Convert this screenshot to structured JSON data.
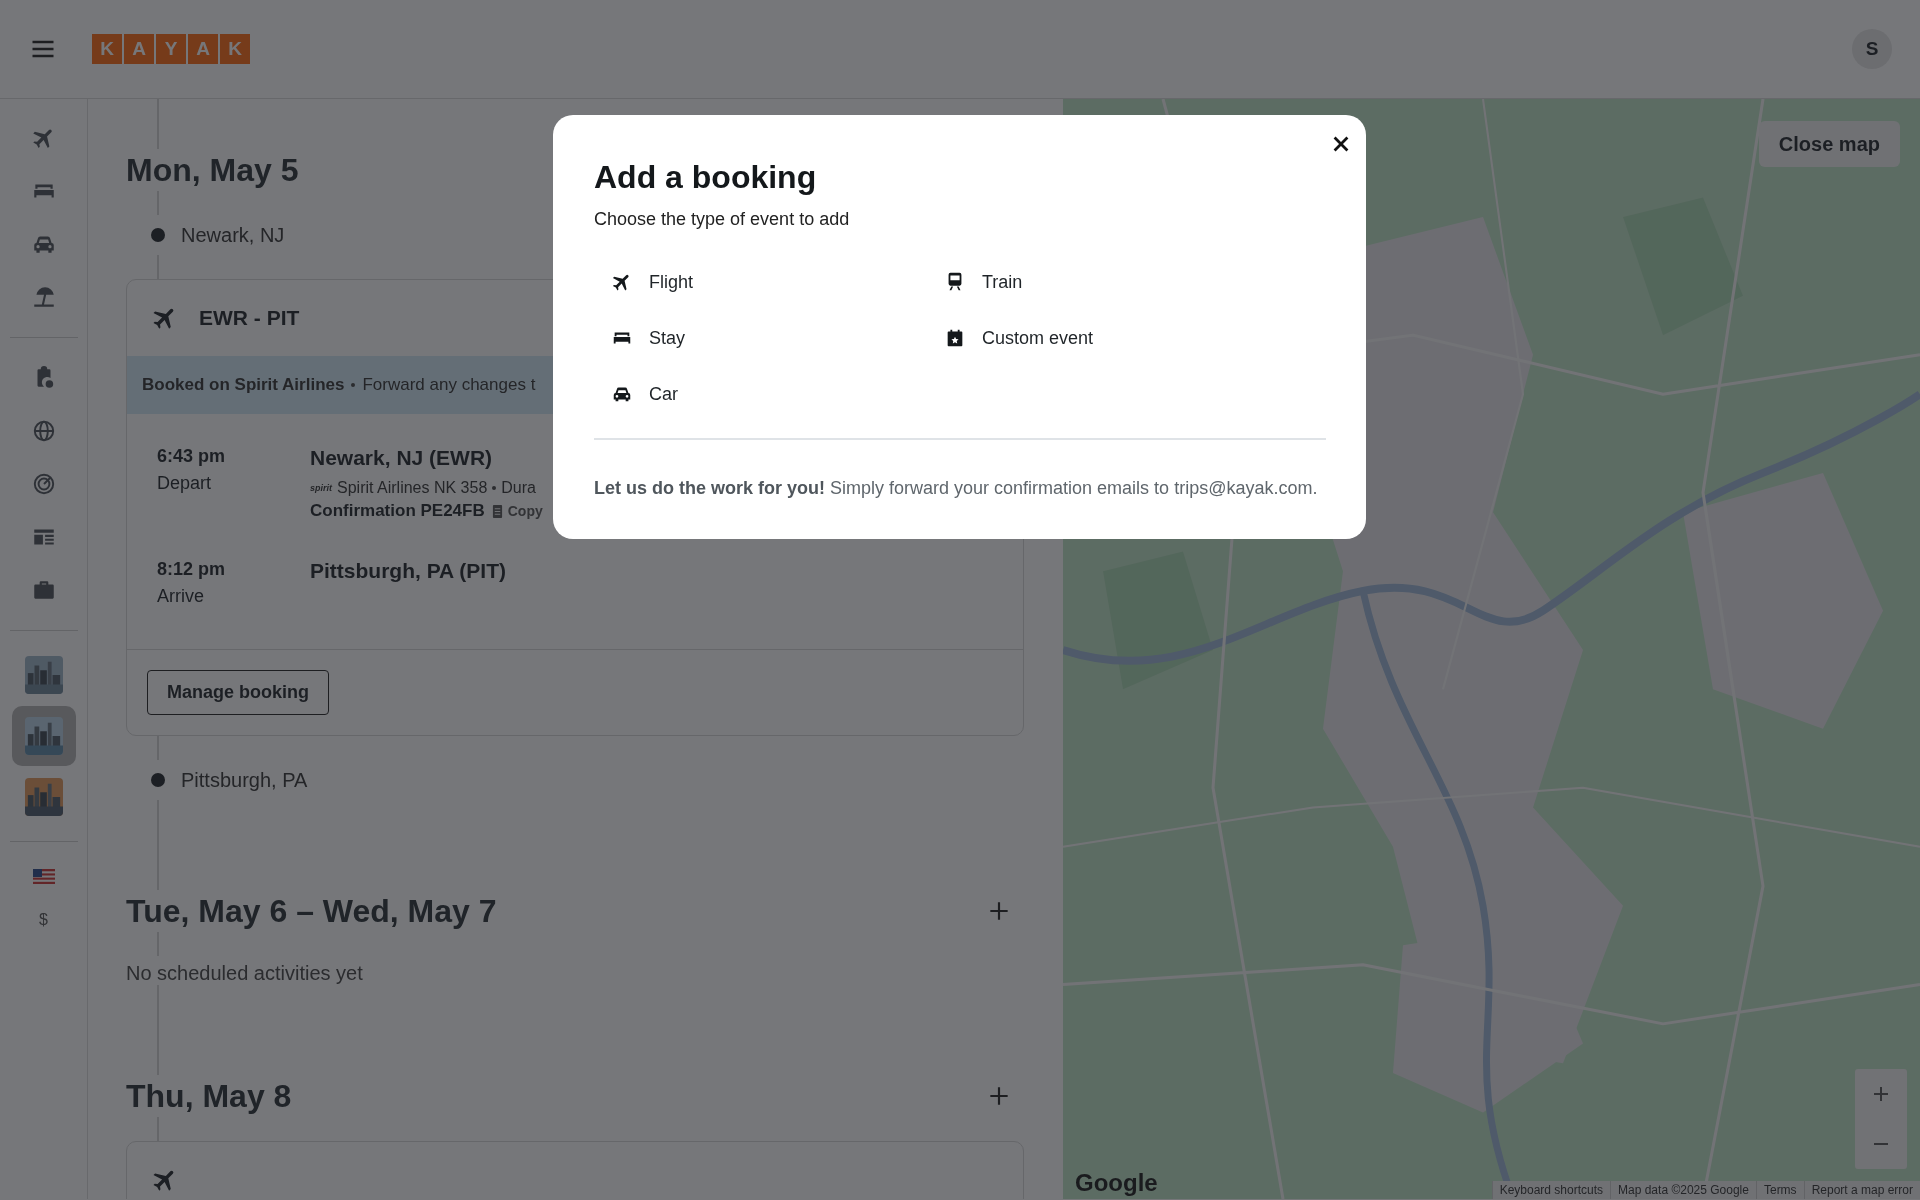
{
  "header": {
    "logo": [
      "K",
      "A",
      "Y",
      "A",
      "K"
    ],
    "avatar": "S"
  },
  "sidebar": {
    "trips": [
      {
        "kind": "picture",
        "selected": false
      },
      {
        "kind": "picture",
        "selected": true
      },
      {
        "kind": "picture",
        "selected": false
      }
    ],
    "currency": "$"
  },
  "itinerary": [
    {
      "title": "Mon, May 5",
      "add_button": false,
      "entries": [
        {
          "kind": "stop",
          "place": "Newark, NJ"
        },
        {
          "kind": "flight",
          "route": "EWR - PIT",
          "banner_bold": "Booked on Spirit Airlines",
          "banner_text": "Forward any changes t",
          "legs": [
            {
              "time": "6:43 pm",
              "label": "Depart",
              "place": "Newark, NJ (EWR)",
              "airline_logo": "spirit",
              "flight": "Spirit Airlines NK 358",
              "extra": "Dura",
              "confirmation": "Confirmation PE24FB",
              "copy": "Copy"
            },
            {
              "time": "8:12 pm",
              "label": "Arrive",
              "place": "Pittsburgh, PA (PIT)"
            }
          ],
          "button": "Manage booking"
        },
        {
          "kind": "stop",
          "place": "Pittsburgh, PA"
        }
      ]
    },
    {
      "title": "Tue, May 6 – Wed, May 7",
      "add_button": true,
      "entries": [
        {
          "kind": "empty",
          "text": "No scheduled activities yet"
        }
      ]
    },
    {
      "title": "Thu, May 8",
      "add_button": true,
      "entries": [
        {
          "kind": "flight"
        }
      ]
    }
  ],
  "map": {
    "close_button": "Close map",
    "logo": "Google",
    "attribution": [
      "Keyboard shortcuts",
      "Map data ©2025 Google",
      "Terms",
      "Report a map error"
    ]
  },
  "modal": {
    "title": "Add a booking",
    "subtitle": "Choose the type of event to add",
    "options": [
      {
        "kind": "flight",
        "label": "Flight"
      },
      {
        "kind": "train",
        "label": "Train"
      },
      {
        "kind": "stay",
        "label": "Stay"
      },
      {
        "kind": "event",
        "label": "Custom event"
      },
      {
        "kind": "car",
        "label": "Car"
      }
    ],
    "footer": "**Let us do the work for you!** Simply forward your confirmation emails to trips@kayak.com."
  }
}
